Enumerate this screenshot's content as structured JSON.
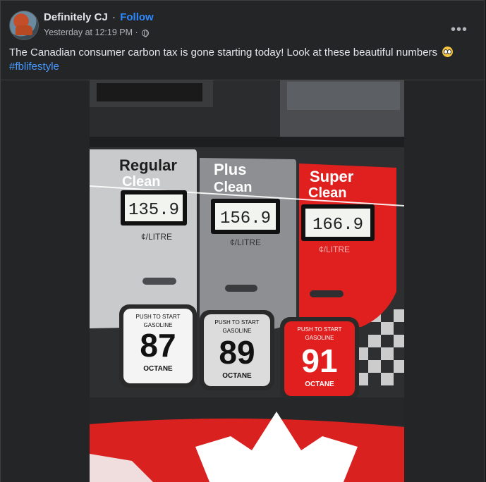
{
  "post": {
    "author": "Definitely CJ",
    "separator": "·",
    "follow_label": "Follow",
    "timestamp": "Yesterday at 12:19 PM",
    "meta_dot": "·",
    "text": "The Canadian consumer carbon tax is gone starting today! Look at these beautiful numbers",
    "hashtag": "#fblifestyle"
  },
  "photo": {
    "grades": [
      {
        "name_line1": "Regular",
        "name_line2": "Clean",
        "price": "135.9",
        "unit": "¢/LITRE",
        "push": "PUSH TO START",
        "fuel": "GASOLINE",
        "octane_num": "87",
        "octane": "OCTANE",
        "color": "#c9cacb"
      },
      {
        "name_line1": "Plus",
        "name_line2": "Clean",
        "price": "156.9",
        "unit": "¢/LITRE",
        "push": "PUSH TO START",
        "fuel": "GASOLINE",
        "octane_num": "89",
        "octane": "OCTANE",
        "color": "#8e8f92"
      },
      {
        "name_line1": "Super",
        "name_line2": "Clean",
        "price": "166.9",
        "unit": "¢/LITRE",
        "push": "PUSH TO START",
        "fuel": "GASOLINE",
        "octane_num": "91",
        "octane": "OCTANE",
        "color": "#e0201f"
      }
    ],
    "colors": {
      "brand_red": "#d9211f",
      "dark": "#2a2a2c"
    }
  },
  "icons": {
    "more": "more-horizontal-icon",
    "globe": "globe-icon",
    "emoji": "flushed-face-emoji"
  }
}
